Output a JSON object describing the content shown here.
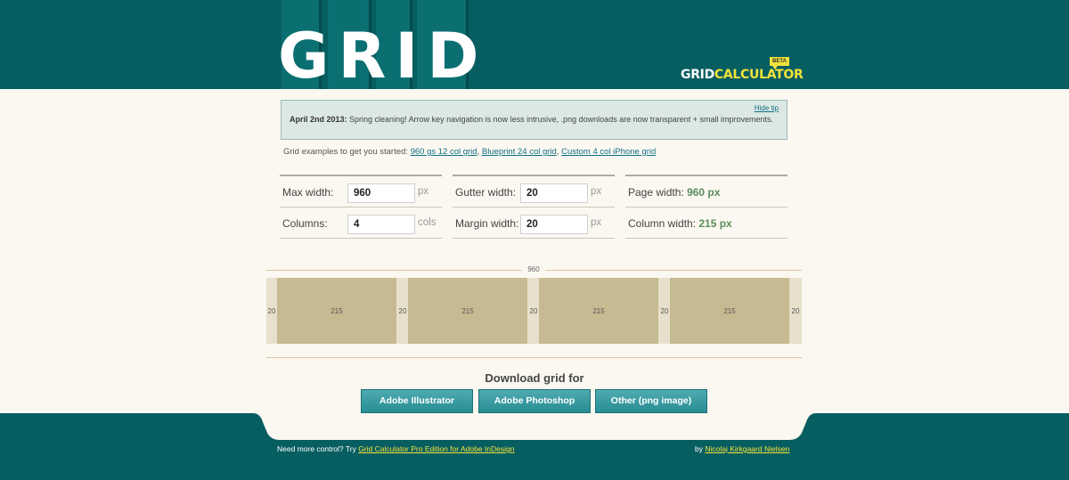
{
  "header": {
    "logo_text": "GRID",
    "brand_left": "GRID",
    "brand_right": "CALCULATOR",
    "beta": "BETA"
  },
  "tip": {
    "hide_label": "Hide tip",
    "date": "April 2nd 2013:",
    "message": " Spring cleaning! Arrow key navigation is now less intrusive, .png downloads are now transparent + small improvements."
  },
  "examples": {
    "prefix": "Grid examples to get you started: ",
    "links": [
      "960 gs 12 col grid",
      "Blueprint 24 col grid",
      "Custom 4 col iPhone grid"
    ]
  },
  "form": {
    "max_width_label": "Max width:",
    "max_width_value": "960",
    "max_width_unit": "px",
    "columns_label": "Columns:",
    "columns_value": "4",
    "columns_unit": "cols",
    "gutter_label": "Gutter width:",
    "gutter_value": "20",
    "gutter_unit": "px",
    "margin_label": "Margin width:",
    "margin_value": "20",
    "margin_unit": "px",
    "page_width_label": "Page width:",
    "page_width_value": "960 px",
    "column_width_label": "Column width:",
    "column_width_value": "215 px"
  },
  "preview": {
    "total_label": "960",
    "columns": [
      "215",
      "215",
      "215",
      "215"
    ],
    "gutters": [
      "20",
      "20",
      "20",
      "20",
      "20"
    ]
  },
  "download": {
    "title": "Download grid for",
    "buttons": [
      "Adobe Illustrator",
      "Adobe Photoshop",
      "Other (png image)"
    ]
  },
  "footer": {
    "left_prefix": "Need more control? Try ",
    "left_link": "Grid Calculator Pro Edition for Adobe InDesign",
    "right_prefix": "by ",
    "right_link": "Nicolaj Kirkgaard Nielsen"
  },
  "colors": {
    "header_bg": "#075e61",
    "accent_yellow": "#f3e23b",
    "result_green": "#5b8c5a",
    "column_fill": "#c6ba92",
    "button_teal": "#278d94"
  }
}
